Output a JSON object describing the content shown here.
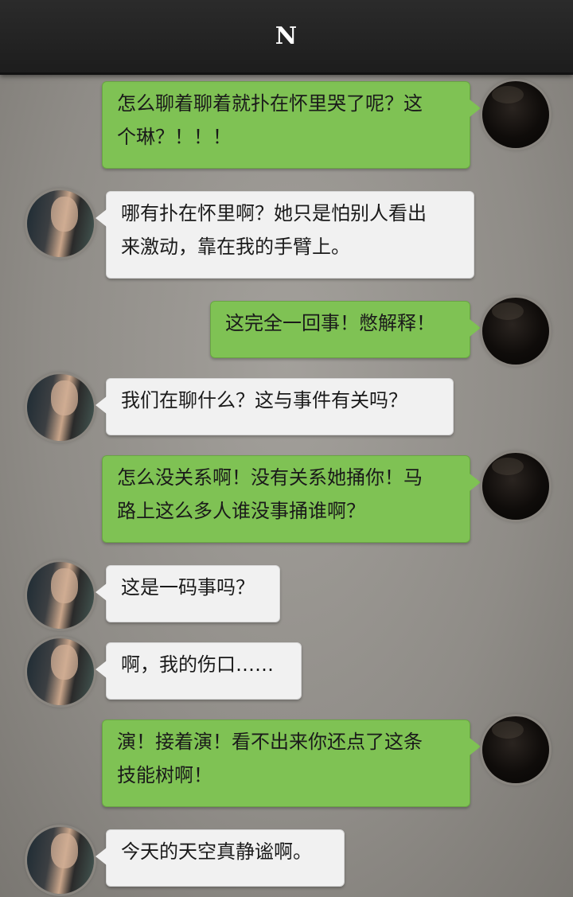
{
  "header": {
    "title": "N"
  },
  "messages": [
    {
      "sender": "me",
      "text": "怎么聊着聊着就扑在怀里哭了呢？这个琳？！！！",
      "lines": [
        "怎么聊着聊着就扑在怀里哭了呢？这",
        "个琳？！！！"
      ]
    },
    {
      "sender": "other",
      "text": "哪有扑在怀里啊？她只是怕别人看出来激动，靠在我的手臂上。",
      "lines": [
        "哪有扑在怀里啊？她只是怕别人看出",
        "来激动，靠在我的手臂上。"
      ]
    },
    {
      "sender": "me",
      "text": "这完全一回事！憋解释！",
      "lines": [
        "这完全一回事！憋解释！"
      ]
    },
    {
      "sender": "other",
      "text": "我们在聊什么？这与事件有关吗？",
      "lines": [
        "我们在聊什么？这与事件有关吗？"
      ]
    },
    {
      "sender": "me",
      "text": "怎么没关系啊！没有关系她捅你！马路上这么多人谁没事捅谁啊？",
      "lines": [
        "怎么没关系啊！没有关系她捅你！马",
        "路上这么多人谁没事捅谁啊？"
      ]
    },
    {
      "sender": "other",
      "text": "这是一码事吗？",
      "lines": [
        "这是一码事吗？"
      ]
    },
    {
      "sender": "other",
      "text": "啊，我的伤口……",
      "lines": [
        "啊，我的伤口……"
      ]
    },
    {
      "sender": "me",
      "text": "演！接着演！看不出来你还点了这条技能树啊！",
      "lines": [
        "演！接着演！看不出来你还点了这条",
        "技能树啊！"
      ]
    },
    {
      "sender": "other",
      "text": "今天的天空真静谧啊。",
      "lines": [
        "今天的天空真静谧啊。"
      ]
    }
  ],
  "colors": {
    "me_bubble": "#7fc254",
    "other_bubble": "#f1f1f1",
    "header": "#222222"
  }
}
